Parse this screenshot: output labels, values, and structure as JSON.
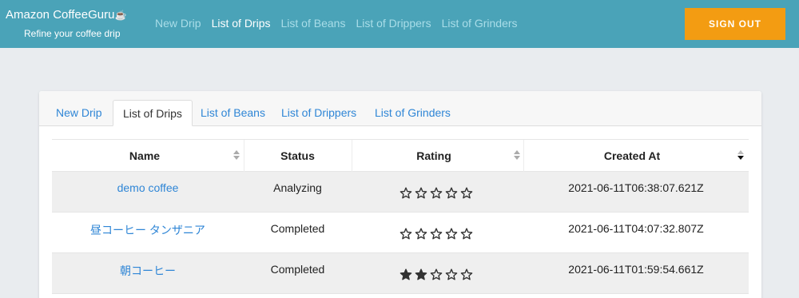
{
  "app": {
    "title": "Amazon CoffeeGuru",
    "title_icon": "☕",
    "subtitle": "Refine your coffee drip"
  },
  "topnav": [
    {
      "label": "New Drip",
      "active": false
    },
    {
      "label": "List of Drips",
      "active": true
    },
    {
      "label": "List of Beans",
      "active": false
    },
    {
      "label": "List of Drippers",
      "active": false
    },
    {
      "label": "List of Grinders",
      "active": false
    }
  ],
  "signout_label": "SIGN OUT",
  "tabs": [
    {
      "label": "New Drip",
      "active": false
    },
    {
      "label": "List of Drips",
      "active": true
    },
    {
      "label": "List of Beans",
      "active": false
    },
    {
      "label": "List of Drippers",
      "active": false
    },
    {
      "label": "List of Grinders",
      "active": false
    }
  ],
  "table": {
    "columns": [
      {
        "label": "Name",
        "sort": "none"
      },
      {
        "label": "Status",
        "sort": "none"
      },
      {
        "label": "Rating",
        "sort": "none"
      },
      {
        "label": "Created At",
        "sort": "desc"
      }
    ],
    "rows": [
      {
        "name": "demo coffee",
        "status": "Analyzing",
        "rating": 0,
        "created_at": "2021-06-11T06:38:07.621Z"
      },
      {
        "name": "昼コーヒー タンザニア",
        "status": "Completed",
        "rating": 0,
        "created_at": "2021-06-11T04:07:32.807Z"
      },
      {
        "name": "朝コーヒー",
        "status": "Completed",
        "rating": 2,
        "created_at": "2021-06-11T01:59:54.661Z"
      }
    ],
    "max_rating": 5
  },
  "colors": {
    "header_bg": "#4aa3b8",
    "signout_bg": "#f39c12",
    "link": "#2f86d6",
    "page_bg": "#e9ecef"
  }
}
